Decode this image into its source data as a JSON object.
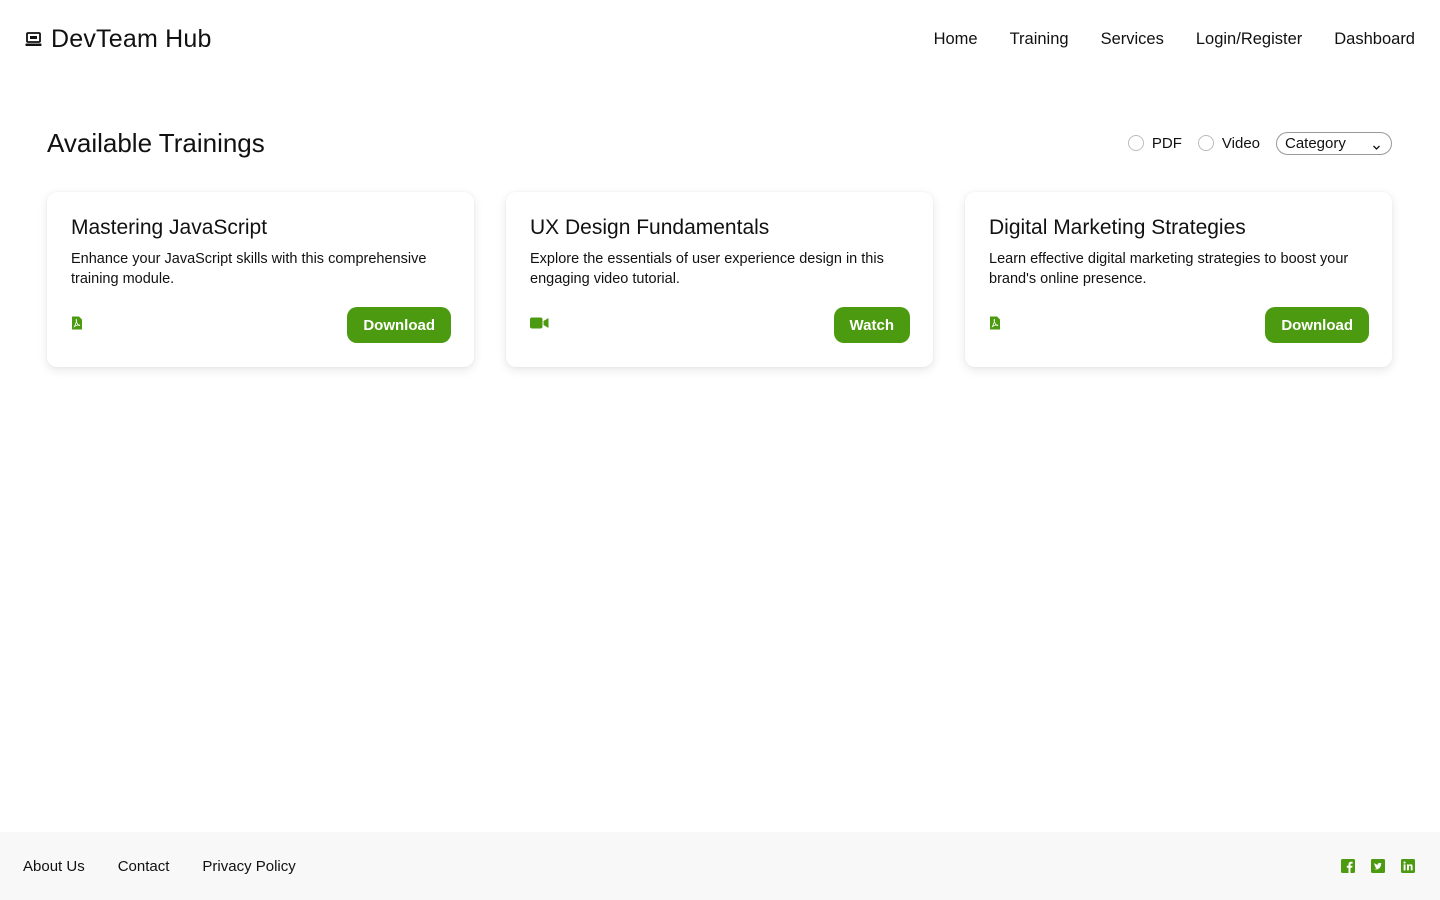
{
  "brand": {
    "name": "DevTeam Hub",
    "icon": "laptop-icon"
  },
  "nav": {
    "items": [
      {
        "label": "Home"
      },
      {
        "label": "Training"
      },
      {
        "label": "Services"
      },
      {
        "label": "Login/Register"
      },
      {
        "label": "Dashboard"
      }
    ]
  },
  "section": {
    "title": "Available Trainings",
    "filters": {
      "pdf_label": "PDF",
      "video_label": "Video",
      "category_value": "Category"
    }
  },
  "cards": [
    {
      "title": "Mastering JavaScript",
      "description": "Enhance your JavaScript skills with this comprehensive training module.",
      "type_icon": "file-pdf-icon",
      "button_label": "Download"
    },
    {
      "title": "UX Design Fundamentals",
      "description": "Explore the essentials of user experience design in this engaging video tutorial.",
      "type_icon": "video-camera-icon",
      "button_label": "Watch"
    },
    {
      "title": "Digital Marketing Strategies",
      "description": "Learn effective digital marketing strategies to boost your brand's online presence.",
      "type_icon": "file-pdf-icon",
      "button_label": "Download"
    }
  ],
  "footer": {
    "links": [
      {
        "label": "About Us"
      },
      {
        "label": "Contact"
      },
      {
        "label": "Privacy Policy"
      }
    ],
    "socials": [
      "facebook-icon",
      "twitter-icon",
      "linkedin-icon"
    ]
  },
  "colors": {
    "accent": "#4b9a10",
    "footer_bg": "#f8f8f8"
  }
}
